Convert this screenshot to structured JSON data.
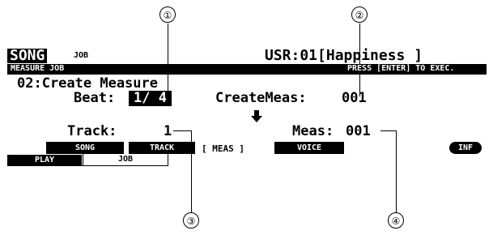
{
  "header": {
    "mode": "SONG",
    "submode": "JOB",
    "song": "USR:01[Happiness ]"
  },
  "subheader": {
    "left": "MEASURE JOB",
    "right": "PRESS [ENTER] TO EXEC."
  },
  "job": {
    "title": "02:Create Measure",
    "beat_label": "Beat:",
    "beat_value": "1/ 4",
    "create_meas_label": "CreateMeas:",
    "create_meas_value": "001",
    "track_label": "Track:",
    "track_value": "1",
    "meas_label": "Meas:",
    "meas_value": "001"
  },
  "softkeys": {
    "song": "SONG",
    "track": "TRACK",
    "meas": "[ MEAS ]",
    "voice": "VOICE",
    "inf": "INF"
  },
  "tabs": {
    "play": "PLAY",
    "job": "JOB"
  },
  "callouts": [
    "①",
    "②",
    "③",
    "④"
  ],
  "icons": {
    "arrow": "down-arrow-icon"
  }
}
